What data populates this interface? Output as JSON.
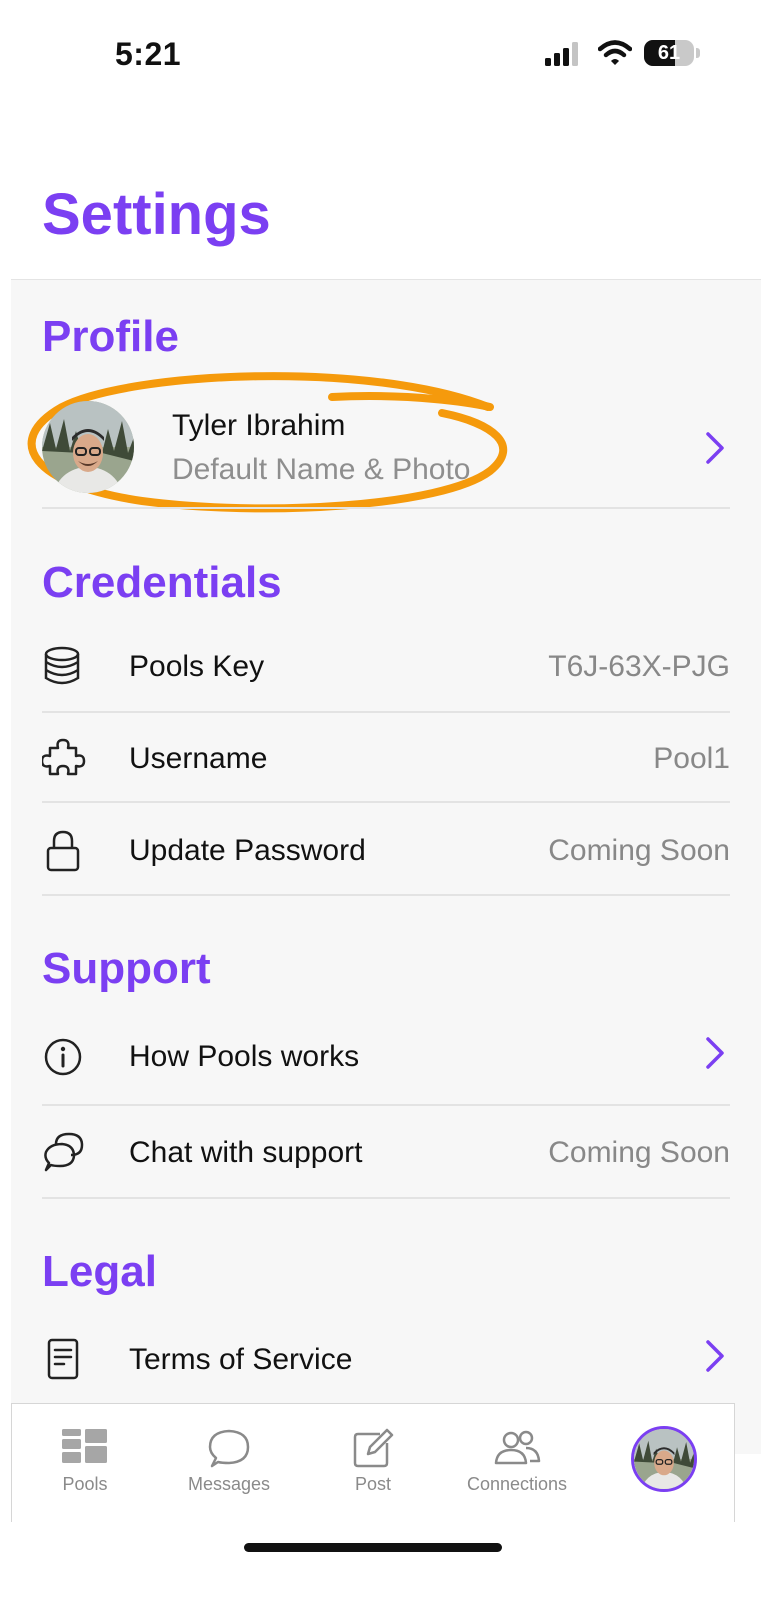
{
  "status_bar": {
    "time": "5:21",
    "battery": "61",
    "battery_level": 0.61
  },
  "title": "Settings",
  "profile": {
    "heading": "Profile",
    "name": "Tyler Ibrahim",
    "subtitle": "Default Name & Photo",
    "avatar_icon": "avatar"
  },
  "credentials": {
    "heading": "Credentials",
    "items": [
      {
        "label": "Pools Key",
        "value": "T6J-63X-PJG",
        "icon": "database-icon"
      },
      {
        "label": "Username",
        "value": "Pool1",
        "icon": "puzzle-icon"
      },
      {
        "label": "Update Password",
        "value": "Coming Soon",
        "icon": "lock-icon"
      }
    ]
  },
  "support": {
    "heading": "Support",
    "items": [
      {
        "label": "How Pools works",
        "icon": "info-icon"
      },
      {
        "label": "Chat with support",
        "value": "Coming Soon",
        "icon": "chat-bubbles-icon"
      }
    ]
  },
  "legal": {
    "heading": "Legal",
    "items": [
      {
        "label": "Terms of Service",
        "icon": "document-icon"
      }
    ]
  },
  "tabs": [
    {
      "label": "Pools",
      "icon": "pools-grid-icon"
    },
    {
      "label": "Messages",
      "icon": "message-bubble-icon"
    },
    {
      "label": "Post",
      "icon": "compose-icon"
    },
    {
      "label": "Connections",
      "icon": "people-icon"
    },
    {
      "label": "",
      "icon": "profile-avatar"
    }
  ],
  "colors": {
    "accent": "#7b3ff2",
    "highlight": "#f59a0c",
    "muted": "#888888"
  }
}
